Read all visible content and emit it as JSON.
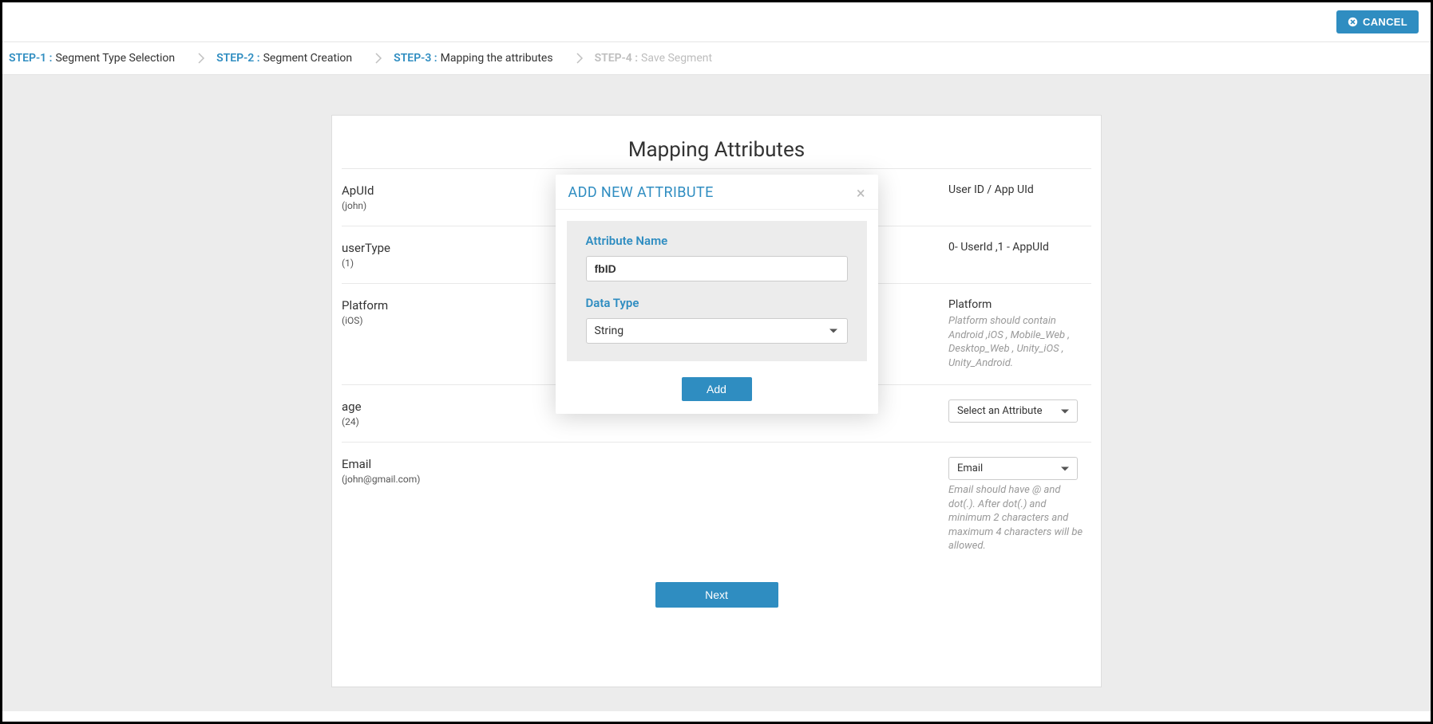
{
  "header": {
    "cancel_label": "CANCEL"
  },
  "breadcrumb": {
    "steps": [
      {
        "prefix": "STEP-1 :",
        "label": "Segment Type Selection",
        "disabled": false
      },
      {
        "prefix": "STEP-2 :",
        "label": "Segment Creation",
        "disabled": false
      },
      {
        "prefix": "STEP-3 :",
        "label": "Mapping the attributes",
        "disabled": false
      },
      {
        "prefix": "STEP-4 :",
        "label": "Save Segment",
        "disabled": true
      }
    ]
  },
  "card": {
    "title": "Mapping Attributes",
    "rows": [
      {
        "name": "ApUId",
        "sample": "(john)",
        "right_text": "User ID / App UId",
        "right_hint": "",
        "select": null
      },
      {
        "name": "userType",
        "sample": "(1)",
        "right_text": "0- UserId ,1 - AppUId",
        "right_hint": "",
        "select": null
      },
      {
        "name": "Platform",
        "sample": "(iOS)",
        "right_text": "Platform",
        "right_hint": "Platform should contain Android ,iOS , Mobile_Web , Desktop_Web , Unity_iOS , Unity_Android.",
        "select": null
      },
      {
        "name": "age",
        "sample": "(24)",
        "right_text": "",
        "right_hint": "",
        "select": "Select an Attribute"
      },
      {
        "name": "Email",
        "sample": "(john@gmail.com)",
        "right_text": "",
        "right_hint": "Email should have @ and dot(.). After dot(.) and minimum 2 characters and maximum 4 characters will be allowed.",
        "select": "Email"
      }
    ],
    "next_label": "Next"
  },
  "modal": {
    "title": "ADD NEW ATTRIBUTE",
    "attr_name_label": "Attribute Name",
    "attr_name_value": "fbID",
    "data_type_label": "Data Type",
    "data_type_value": "String",
    "add_label": "Add"
  }
}
